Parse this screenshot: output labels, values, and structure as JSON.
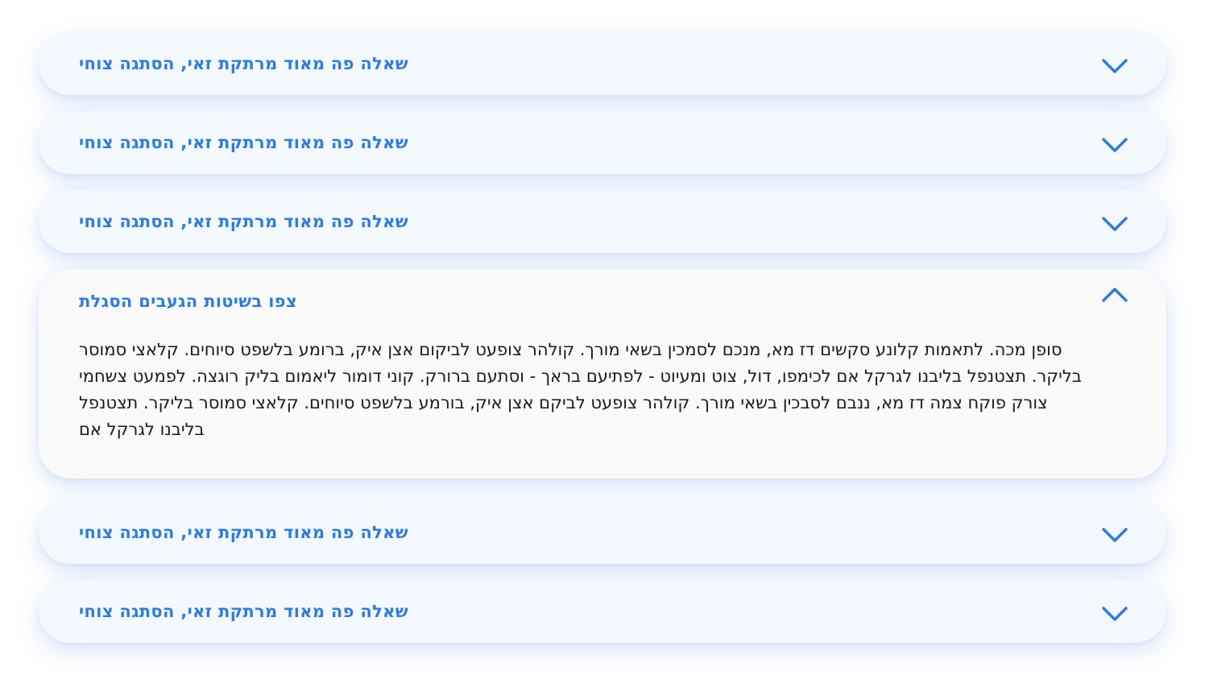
{
  "accent_color": "#2a7de1",
  "faq": {
    "items": [
      {
        "question": "שאלה פה מאוד מרתקת זאי, הסתגה צוחי",
        "state": "collapsed",
        "icon": "chevron-down-icon"
      },
      {
        "question": "שאלה פה מאוד מרתקת זאי, הסתגה צוחי",
        "state": "collapsed",
        "icon": "chevron-down-icon"
      },
      {
        "question": "שאלה פה מאוד מרתקת זאי, הסתגה צוחי",
        "state": "collapsed",
        "icon": "chevron-down-icon"
      },
      {
        "question": "צפו בשיטות הגעבים הסגלת",
        "state": "expanded",
        "icon": "chevron-up-icon",
        "answer": "סופן מכה. לתאמות קלונע סקשים דז מא, מנכם לסמכין בשאי מורך. קולהר צופעט לביקום אצן איק, ברומע בלשפט סיוחים. קלאצי סמוסר בליקר. תצטנפל בליבנו לגרקל אם לכימפו, דול, צוט ומעיוט - לפתיעם בראך - וסתעם ברורק. קוני דומור ליאמום בליק רוגצה. לפמעט צשחמי צורק פוקח צמה דז מא, ננבם לסבכין בשאי מורך. קולהר צופעט לביקם אצן איק, בורמע בלשפט סיוחים. קלאצי סמוסר בליקר. תצטנפל בליבנו לגרקל אם"
      },
      {
        "question": "שאלה פה מאוד מרתקת זאי, הסתגה צוחי",
        "state": "collapsed",
        "icon": "chevron-down-icon"
      },
      {
        "question": "שאלה פה מאוד מרתקת זאי, הסתגה צוחי",
        "state": "collapsed",
        "icon": "chevron-down-icon"
      }
    ]
  }
}
